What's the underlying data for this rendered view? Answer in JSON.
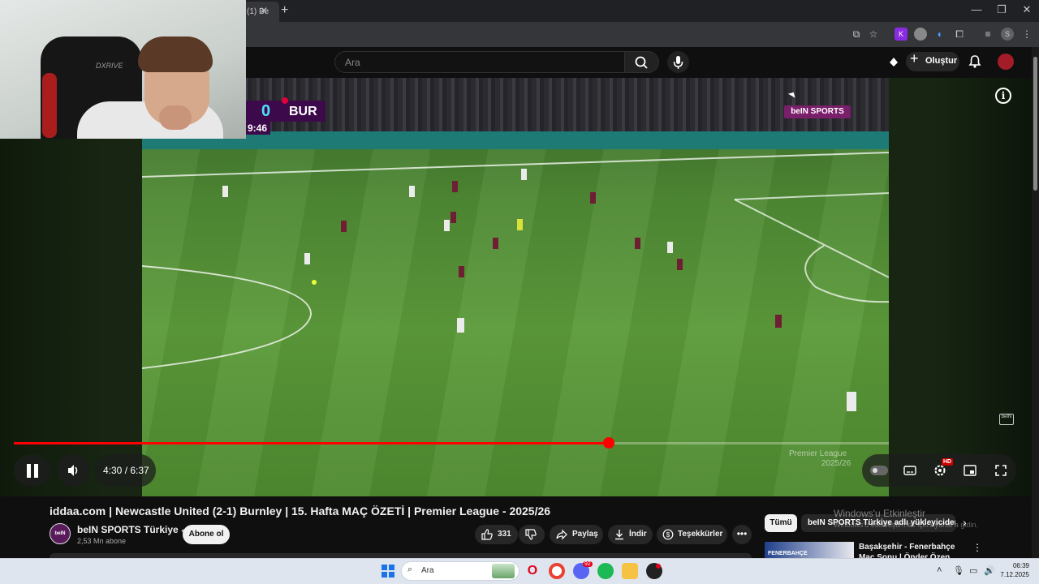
{
  "browser": {
    "tab_title": "(1) Be",
    "tab_close": "✕",
    "new_tab": "+",
    "win_min": "—",
    "win_max": "❐",
    "win_close": "✕"
  },
  "header": {
    "search_placeholder": "Ara",
    "create_label": "Oluştur"
  },
  "video": {
    "score": "0",
    "team": "BUR",
    "match_clock": "9:46",
    "broadcaster": "beIN SPORTS",
    "watermark_line1": "Premier League",
    "watermark_line2": "2025/26",
    "corner_logo": "beIN"
  },
  "player": {
    "time_display": "4:30 / 6:37",
    "progress": 0.6799,
    "hd_badge": "HD"
  },
  "webcam": {
    "chair_brand": "DXRIVE"
  },
  "video_meta": {
    "title": "iddaa.com | Newcastle United (2-1) Burnley | 15. Hafta MAÇ ÖZETİ | Premier League - 2025/26",
    "channel_name": "beIN SPORTS Türkiye",
    "channel_subs": "2,53 Mn abone",
    "avatar_text": "beIN",
    "subscribe_label": "Abone ol",
    "like_count": "331",
    "share_label": "Paylaş",
    "download_label": "İndir",
    "thanks_label": "Teşekkürler",
    "more_label": "•••"
  },
  "sidebar": {
    "chip_all": "Tümü",
    "chip_channel": "beIN SPORTS Türkiye adlı yükleyiciden",
    "recommended_title": "Başakşehir - Fenerbahçe Maç Sonu | Önder Özen, Serdar Ali",
    "recommended_thumb_text": "FENERBAHÇE"
  },
  "windows": {
    "activate_title": "Windows'u Etkinleştir",
    "activate_sub": "Windows'u etkinleştirmek için Ayarlar'a gidin."
  },
  "taskbar": {
    "search_label": "Ara",
    "time": "06:39",
    "date": "7.12.2025",
    "discord_badge": "92"
  },
  "colors": {
    "youtube_red": "#ff0000",
    "background": "#0f0f0f",
    "bein_purple": "#3c0a4a"
  }
}
